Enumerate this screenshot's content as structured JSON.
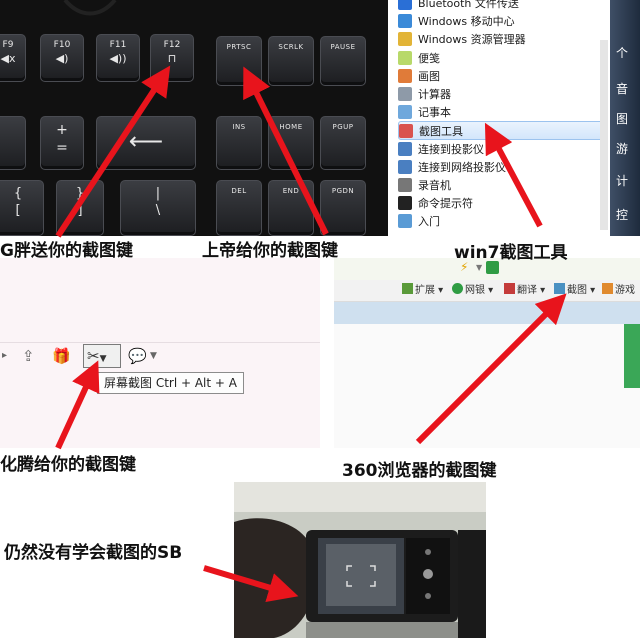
{
  "keyboard": {
    "keys": [
      {
        "id": "f9",
        "label": "F9",
        "glyph": "🔇"
      },
      {
        "id": "f10",
        "label": "F10",
        "glyph": "🔉"
      },
      {
        "id": "f11",
        "label": "F11",
        "glyph": "🔊"
      },
      {
        "id": "f12",
        "label": "F12",
        "glyph": "🔒"
      },
      {
        "id": "prtsc",
        "label": "PRTSC"
      },
      {
        "id": "scrlk",
        "label": "SCRLK"
      },
      {
        "id": "pause",
        "label": "PAUSE"
      },
      {
        "id": "plus",
        "label": "+",
        "sub": "="
      },
      {
        "id": "minus",
        "label": "-"
      },
      {
        "id": "backspace",
        "glyph": "⟵"
      },
      {
        "id": "ins",
        "label": "INS"
      },
      {
        "id": "home",
        "label": "HOME"
      },
      {
        "id": "pgup",
        "label": "PGUP"
      },
      {
        "id": "lbrace",
        "label": "{",
        "sub": "["
      },
      {
        "id": "rbrace",
        "label": "}",
        "sub": "]"
      },
      {
        "id": "pipe",
        "label": "|",
        "sub": "\\"
      },
      {
        "id": "del",
        "label": "DEL"
      },
      {
        "id": "end",
        "label": "END"
      },
      {
        "id": "pgdn",
        "label": "PGDN"
      }
    ]
  },
  "win_menu": {
    "items": [
      {
        "label": "Bluetooth 文件传送",
        "icon": "bluetooth-icon",
        "color": "#2a6fd6"
      },
      {
        "label": "Windows 移动中心",
        "icon": "mobility-center-icon",
        "color": "#3b8ad8"
      },
      {
        "label": "Windows 资源管理器",
        "icon": "explorer-icon",
        "color": "#e2b437"
      },
      {
        "label": "便笺",
        "icon": "sticky-notes-icon",
        "color": "#b8d96a"
      },
      {
        "label": "画图",
        "icon": "paint-icon",
        "color": "#e07b39"
      },
      {
        "label": "计算器",
        "icon": "calculator-icon",
        "color": "#8e9aa8"
      },
      {
        "label": "记事本",
        "icon": "notepad-icon",
        "color": "#6fa8dc"
      },
      {
        "label": "截图工具",
        "icon": "snipping-tool-icon",
        "color": "#d9534f",
        "selected": true
      },
      {
        "label": "连接到投影仪",
        "icon": "projector-icon",
        "color": "#4a7fc1"
      },
      {
        "label": "连接到网络投影仪",
        "icon": "network-projector-icon",
        "color": "#4a7fc1"
      },
      {
        "label": "录音机",
        "icon": "sound-recorder-icon",
        "color": "#777777"
      },
      {
        "label": "命令提示符",
        "icon": "cmd-icon",
        "color": "#222222"
      },
      {
        "label": "入门",
        "icon": "getting-started-icon",
        "color": "#5a9bd5"
      }
    ],
    "right_pane": [
      "个",
      "音",
      "图",
      "游",
      "计",
      "控"
    ]
  },
  "qq_toolbar": {
    "tooltip": "屏幕截图 Ctrl + Alt + A"
  },
  "browser_360": {
    "items": [
      {
        "label": "扩展",
        "icon": "extensions-icon",
        "color": "#5a9a3a"
      },
      {
        "label": "网银",
        "icon": "online-banking-icon",
        "color": "#2f9c44"
      },
      {
        "label": "翻译",
        "icon": "translate-icon",
        "color": "#c43b3b"
      },
      {
        "label": "截图",
        "icon": "screenshot-icon",
        "color": "#4a90c2"
      },
      {
        "label": "游戏",
        "icon": "games-icon",
        "color": "#e08a2e"
      }
    ]
  },
  "captions": {
    "keyboard_left": "G胖送你的截图键",
    "keyboard_right": "上帝给你的截图键",
    "win7": "win7截图工具",
    "qq": "化腾给你的截图键",
    "browser360": "360浏览器的截图键",
    "phone": "仍然没有学会截图的SB"
  },
  "colors": {
    "arrow": "#e8141c",
    "tooltip_border": "#8c8c8c",
    "win_selection": "#d3e6fb"
  }
}
